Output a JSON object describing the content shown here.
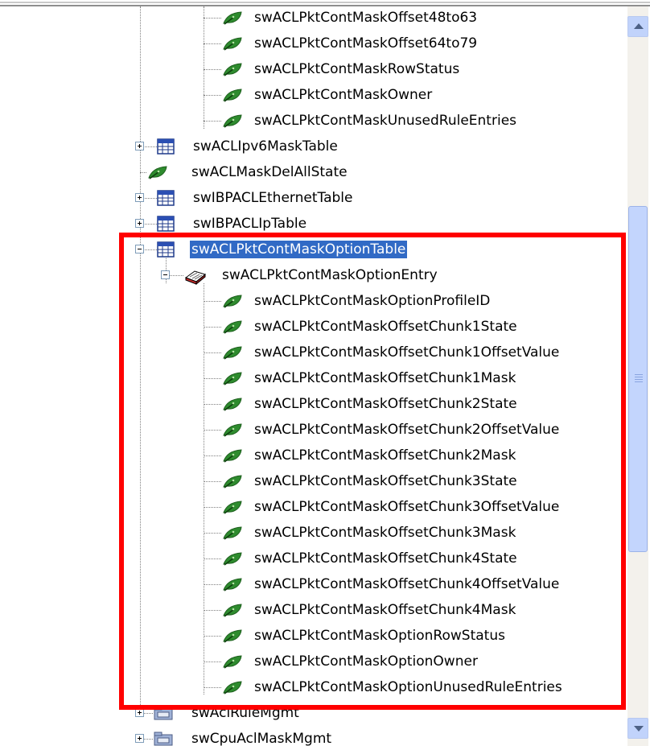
{
  "tree": {
    "rows_above": [
      {
        "label": "swACLPktContMaskOffset48to63",
        "icon": "leaf-icon"
      },
      {
        "label": "swACLPktContMaskOffset64to79",
        "icon": "leaf-icon"
      },
      {
        "label": "swACLPktContMaskRowStatus",
        "icon": "leaf-icon"
      },
      {
        "label": "swACLPktContMaskOwner",
        "icon": "leaf-icon"
      },
      {
        "label": "swACLPktContMaskUnusedRuleEntries",
        "icon": "leaf-icon"
      }
    ],
    "siblings": [
      {
        "label": "swACLIpv6MaskTable",
        "icon": "table-icon",
        "expandable": true
      },
      {
        "label": "swACLMaskDelAllState",
        "icon": "leaf-icon",
        "expandable": false
      },
      {
        "label": "swIBPACLEthernetTable",
        "icon": "table-icon",
        "expandable": true
      },
      {
        "label": "swIBPACLIpTable",
        "icon": "table-icon",
        "expandable": true
      }
    ],
    "selected_table": {
      "label": "swACLPktContMaskOptionTable",
      "icon": "table-icon",
      "expanded": true
    },
    "entry": {
      "label": "swACLPktContMaskOptionEntry",
      "icon": "entry-icon",
      "expanded": true
    },
    "entry_children": [
      "swACLPktContMaskOptionProfileID",
      "swACLPktContMaskOffsetChunk1State",
      "swACLPktContMaskOffsetChunk1OffsetValue",
      "swACLPktContMaskOffsetChunk1Mask",
      "swACLPktContMaskOffsetChunk2State",
      "swACLPktContMaskOffsetChunk2OffsetValue",
      "swACLPktContMaskOffsetChunk2Mask",
      "swACLPktContMaskOffsetChunk3State",
      "swACLPktContMaskOffsetChunk3OffsetValue",
      "swACLPktContMaskOffsetChunk3Mask",
      "swACLPktContMaskOffsetChunk4State",
      "swACLPktContMaskOffsetChunk4OffsetValue",
      "swACLPktContMaskOffsetChunk4Mask",
      "swACLPktContMaskOptionRowStatus",
      "swACLPktContMaskOptionOwner",
      "swACLPktContMaskOptionUnusedRuleEntries"
    ],
    "rows_below": [
      {
        "label": "swAclRuleMgmt",
        "icon": "folder-icon"
      },
      {
        "label": "swCpuAclMaskMgmt",
        "icon": "folder-icon"
      }
    ]
  },
  "colors": {
    "selection": "#316ac5",
    "highlight_box": "#ff0000",
    "leaf": "#2e8b2e"
  }
}
